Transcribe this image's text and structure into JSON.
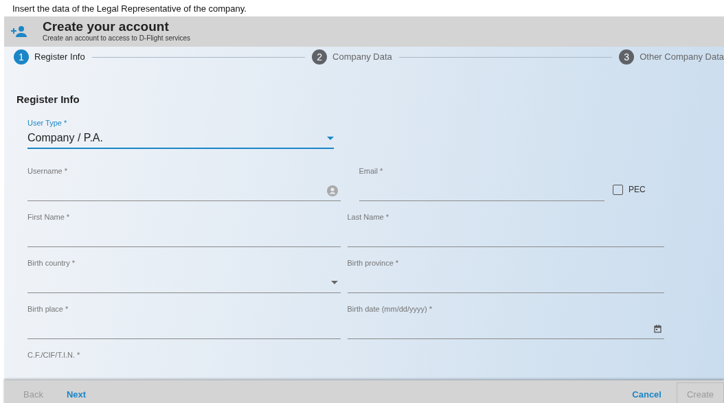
{
  "instruction": "Insert the data of the Legal Representative of the company.",
  "dialog": {
    "title": "Create your account",
    "subtitle": "Create an account to access to D-Flight services"
  },
  "steps": [
    {
      "number": "1",
      "label": "Register Info",
      "selected": true
    },
    {
      "number": "2",
      "label": "Company Data",
      "selected": false
    },
    {
      "number": "3",
      "label": "Other Company Data",
      "selected": false
    }
  ],
  "section_title": "Register Info",
  "user_type": {
    "label": "User Type *",
    "value": "Company / P.A.",
    "focused": true
  },
  "fields": [
    {
      "kind": "username",
      "label": "Username *"
    },
    {
      "kind": "email",
      "label": "Email *",
      "checkbox": {
        "label": "PEC",
        "checked": false
      }
    },
    {
      "kind": "text",
      "label": "First Name *"
    },
    {
      "kind": "text",
      "label": "Last Name *"
    },
    {
      "kind": "select",
      "label": "Birth country *"
    },
    {
      "kind": "text",
      "label": "Birth province *"
    },
    {
      "kind": "text",
      "label": "Birth place *"
    },
    {
      "kind": "date",
      "label": "Birth date (mm/dd/yyyy) *"
    },
    {
      "kind": "text",
      "label": "C.F./CIF/T.I.N. *"
    }
  ],
  "footer": {
    "back": {
      "label": "Back",
      "disabled": true
    },
    "next": {
      "label": "Next",
      "disabled": false
    },
    "cancel": {
      "label": "Cancel",
      "disabled": false
    },
    "create": {
      "label": "Create",
      "disabled": true
    }
  }
}
